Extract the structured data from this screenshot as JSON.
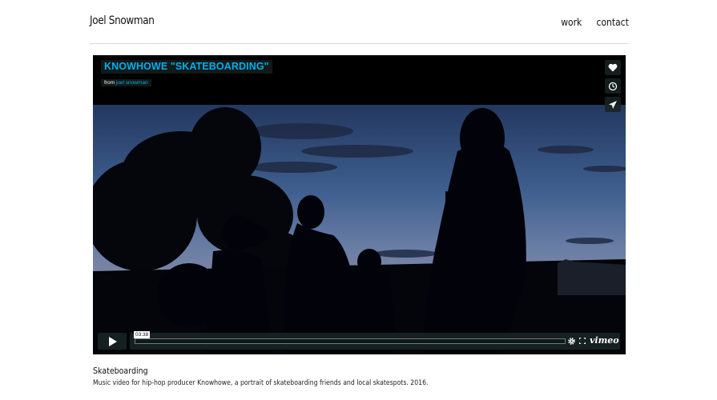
{
  "site": {
    "title": "Joel Snowman",
    "nav": [
      {
        "label": "work"
      },
      {
        "label": "contact"
      }
    ]
  },
  "player": {
    "title": "KNOWHOWE \"SKATEBOARDING\"",
    "byline_prefix": "from",
    "byline_author": "joel snowman",
    "side_buttons": [
      {
        "icon": "heart-icon"
      },
      {
        "icon": "clock-icon"
      },
      {
        "icon": "paper-plane-icon"
      }
    ],
    "time": "03:38",
    "progress_fraction": 0.0,
    "logo": "vimeo",
    "accent_color": "#00adef",
    "controls": [
      "play-icon",
      "gear-icon",
      "fullscreen-icon"
    ]
  },
  "caption": {
    "title": "Skateboarding",
    "description": "Music video for hip-hop producer Knowhowe, a portrait of skateboarding friends and local skatespots. 2016."
  }
}
